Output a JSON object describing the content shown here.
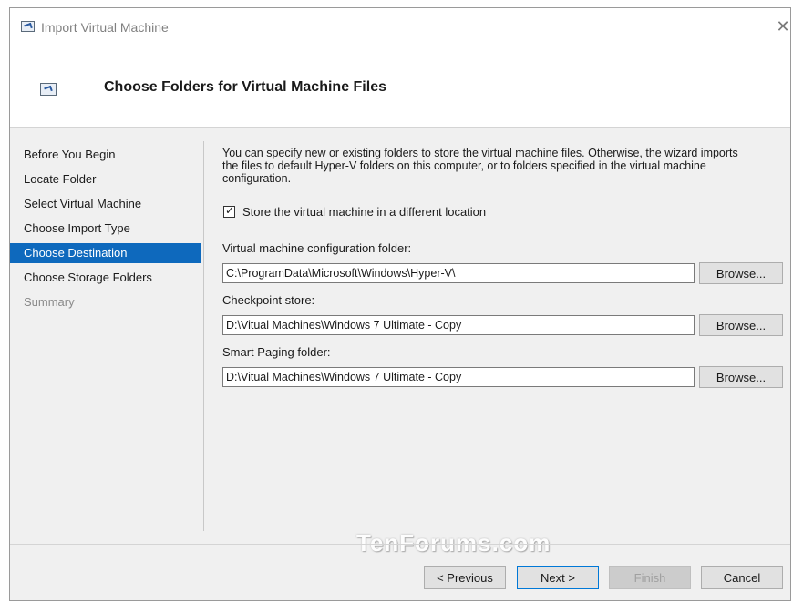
{
  "window": {
    "title": "Import Virtual Machine",
    "close_glyph": "✕"
  },
  "header": {
    "title": "Choose Folders for Virtual Machine Files",
    "icon": "import-vm-icon"
  },
  "nav": {
    "items": [
      {
        "label": "Before You Begin",
        "state": "normal"
      },
      {
        "label": "Locate Folder",
        "state": "normal"
      },
      {
        "label": "Select Virtual Machine",
        "state": "normal"
      },
      {
        "label": "Choose Import Type",
        "state": "normal"
      },
      {
        "label": "Choose Destination",
        "state": "active"
      },
      {
        "label": "Choose Storage Folders",
        "state": "normal"
      },
      {
        "label": "Summary",
        "state": "disabled"
      }
    ]
  },
  "content": {
    "description": "You can specify new or existing folders to store the virtual machine files. Otherwise, the wizard imports the files to default Hyper-V folders on this computer, or to folders specified in the virtual machine configuration.",
    "checkbox": {
      "label": "Store the virtual machine in a different location",
      "checked": true,
      "check_glyph": "✓"
    },
    "fields": [
      {
        "label": "Virtual machine configuration folder:",
        "value": "C:\\ProgramData\\Microsoft\\Windows\\Hyper-V\\",
        "browse_label": "Browse..."
      },
      {
        "label": "Checkpoint store:",
        "value": "D:\\Vitual Machines\\Windows 7 Ultimate - Copy",
        "browse_label": "Browse..."
      },
      {
        "label": "Smart Paging folder:",
        "value": "D:\\Vitual Machines\\Windows 7 Ultimate - Copy",
        "browse_label": "Browse..."
      }
    ]
  },
  "footer": {
    "previous_label": "< Previous",
    "next_label": "Next >",
    "finish_label": "Finish",
    "cancel_label": "Cancel"
  },
  "watermark": "TenForums.com",
  "colors": {
    "active_nav_bg": "#0e69bd",
    "focus_border": "#0078d7"
  }
}
